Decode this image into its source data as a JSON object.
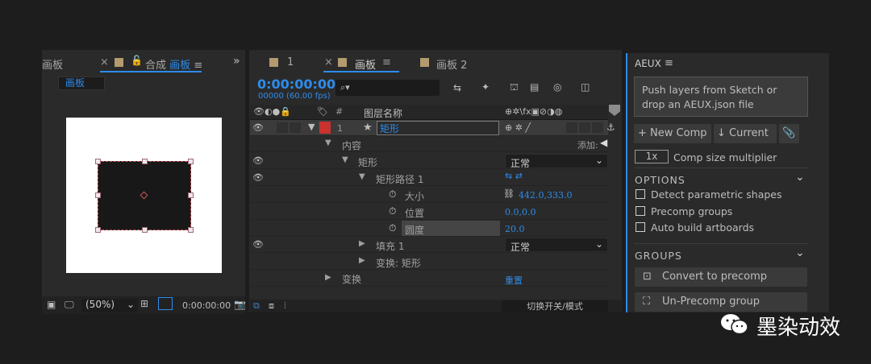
{
  "left_panel": {
    "tab_partial": "画板",
    "tab_name_prefix": "合成",
    "tab_name": "画板",
    "comp_label": "画板",
    "zoom": "(50%)",
    "timecode": "0:00:00:00"
  },
  "timeline": {
    "tabs": [
      "1",
      "画板",
      "画板 2"
    ],
    "timecode": "0:00:00:00",
    "fps": "00000 (60.00 fps)",
    "search_placeholder": "",
    "col_num": "#",
    "col_name": "图层名称",
    "layer_num": "1",
    "layer_name": "矩形",
    "content_label": "内容",
    "add_label": "添加:",
    "rect_label": "矩形",
    "rect_mode": "正常",
    "rect_path_label": "矩形路径 1",
    "size_label": "大小",
    "size_value": "442.0,333.0",
    "pos_label": "位置",
    "pos_value": "0.0,0.0",
    "round_label": "圆度",
    "round_value": "20.0",
    "fill_label": "填充 1",
    "fill_mode": "正常",
    "transform_sub_label": "变换: 矩形",
    "transform_label": "变换",
    "reset_label": "重置",
    "bottom_label": "切换开关/模式"
  },
  "aeux": {
    "title": "AEUX",
    "drop_text": "Push layers from Sketch or drop an AEUX.json file",
    "new_comp": "New Comp",
    "current": "Current",
    "multiplier": "1x",
    "multiplier_label": "Comp size multiplier",
    "options_title": "OPTIONS",
    "options": [
      "Detect parametric shapes",
      "Precomp groups",
      "Auto build artboards"
    ],
    "groups_title": "GROUPS",
    "convert": "Convert to precomp",
    "unprecomp": "Un-Precomp group"
  },
  "watermark": "墨染动效",
  "colors": {
    "accent": "#2d8ceb",
    "layer_label": "#c8322f",
    "panel": "#2a2a2a"
  }
}
